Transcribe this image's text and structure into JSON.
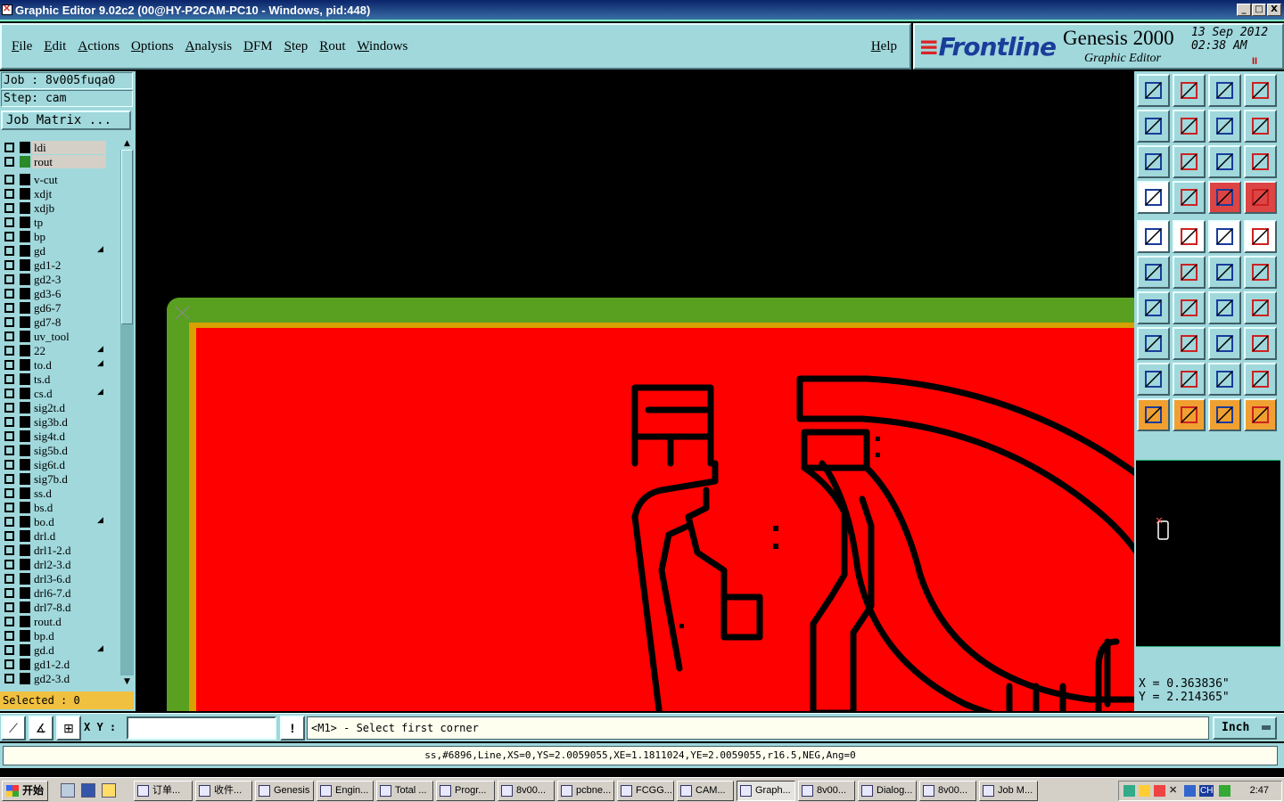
{
  "titlebar": {
    "title": "Graphic Editor 9.02c2 (00@HY-P2CAM-PC10 - Windows, pid:448)",
    "buttons": [
      "_",
      "□",
      "X"
    ]
  },
  "menu": {
    "items": [
      "File",
      "Edit",
      "Actions",
      "Options",
      "Analysis",
      "DFM",
      "Step",
      "Rout",
      "Windows"
    ],
    "help": "Help"
  },
  "brand": {
    "logo": "Frontline",
    "product": "Genesis 2000",
    "subtitle": "Graphic Editor",
    "date": "13 Sep 2012",
    "time": "02:38 AM",
    "pause": "II"
  },
  "job": {
    "job_label": "Job : 8v005fuqa0",
    "step_label": "Step: cam",
    "matrix_button": "Job Matrix ..."
  },
  "layers": [
    {
      "name": "ldi",
      "color": "#000000",
      "selected": true,
      "mark": ""
    },
    {
      "name": "rout",
      "color": "#2a8a2a",
      "selected": true,
      "mark": ""
    },
    {
      "name": "v-cut",
      "color": "#000000",
      "mark": ""
    },
    {
      "name": "xdjt",
      "color": "#000000",
      "mark": ""
    },
    {
      "name": "xdjb",
      "color": "#000000",
      "mark": ""
    },
    {
      "name": "tp",
      "color": "#000000",
      "mark": ""
    },
    {
      "name": "bp",
      "color": "#000000",
      "mark": ""
    },
    {
      "name": "gd",
      "color": "#000000",
      "mark": "◢"
    },
    {
      "name": "gd1-2",
      "color": "#000000",
      "mark": ""
    },
    {
      "name": "gd2-3",
      "color": "#000000",
      "mark": ""
    },
    {
      "name": "gd3-6",
      "color": "#000000",
      "mark": ""
    },
    {
      "name": "gd6-7",
      "color": "#000000",
      "mark": ""
    },
    {
      "name": "gd7-8",
      "color": "#000000",
      "mark": ""
    },
    {
      "name": "uv_tool",
      "color": "#000000",
      "mark": ""
    },
    {
      "name": "22",
      "color": "#000000",
      "mark": "◢"
    },
    {
      "name": "to.d",
      "color": "#000000",
      "mark": "◢"
    },
    {
      "name": "ts.d",
      "color": "#000000",
      "mark": ""
    },
    {
      "name": "cs.d",
      "color": "#000000",
      "mark": "◢"
    },
    {
      "name": "sig2t.d",
      "color": "#000000",
      "mark": ""
    },
    {
      "name": "sig3b.d",
      "color": "#000000",
      "mark": ""
    },
    {
      "name": "sig4t.d",
      "color": "#000000",
      "mark": ""
    },
    {
      "name": "sig5b.d",
      "color": "#000000",
      "mark": ""
    },
    {
      "name": "sig6t.d",
      "color": "#000000",
      "mark": ""
    },
    {
      "name": "sig7b.d",
      "color": "#000000",
      "mark": ""
    },
    {
      "name": "ss.d",
      "color": "#000000",
      "mark": ""
    },
    {
      "name": "bs.d",
      "color": "#000000",
      "mark": ""
    },
    {
      "name": "bo.d",
      "color": "#000000",
      "mark": "◢"
    },
    {
      "name": "drl.d",
      "color": "#000000",
      "mark": ""
    },
    {
      "name": "drl1-2.d",
      "color": "#000000",
      "mark": ""
    },
    {
      "name": "drl2-3.d",
      "color": "#000000",
      "mark": ""
    },
    {
      "name": "drl3-6.d",
      "color": "#000000",
      "mark": ""
    },
    {
      "name": "drl6-7.d",
      "color": "#000000",
      "mark": ""
    },
    {
      "name": "drl7-8.d",
      "color": "#000000",
      "mark": ""
    },
    {
      "name": "rout.d",
      "color": "#000000",
      "mark": ""
    },
    {
      "name": "bp.d",
      "color": "#000000",
      "mark": ""
    },
    {
      "name": "gd.d",
      "color": "#000000",
      "mark": "◢"
    },
    {
      "name": "gd1-2.d",
      "color": "#000000",
      "mark": ""
    },
    {
      "name": "gd2-3.d",
      "color": "#000000",
      "mark": ""
    }
  ],
  "selected_label": "Selected : 0",
  "coords": {
    "x": "X = 0.363836\"",
    "y": "Y = 2.214365\""
  },
  "command": {
    "xy_label": "X Y :",
    "xy_value": "",
    "prompt": "<M1> - Select first corner",
    "units": "Inch"
  },
  "status": "ss,#6896,Line,XS=0,YS=2.0059055,XE=1.1811024,YE=2.0059055,r16.5,NEG,Ang=0",
  "taskbar": {
    "start": "开始",
    "tasks": [
      "订单...",
      "收件...",
      "Genesis",
      "Engin...",
      "Total ...",
      "Progr...",
      "8v00...",
      "pcbne...",
      "FCGG...",
      "CAM...",
      "Graph...",
      "8v00...",
      "Dialog...",
      "8v00...",
      "Job M..."
    ],
    "active_task": "Graph...",
    "tray_lang": "CH",
    "clock": "2:47"
  },
  "colors": {
    "panel": "#a0d8dc",
    "board_fill": "#ff0000",
    "board_border": "#5aa020",
    "traces": "#000000",
    "selected_bar": "#f0c040"
  }
}
